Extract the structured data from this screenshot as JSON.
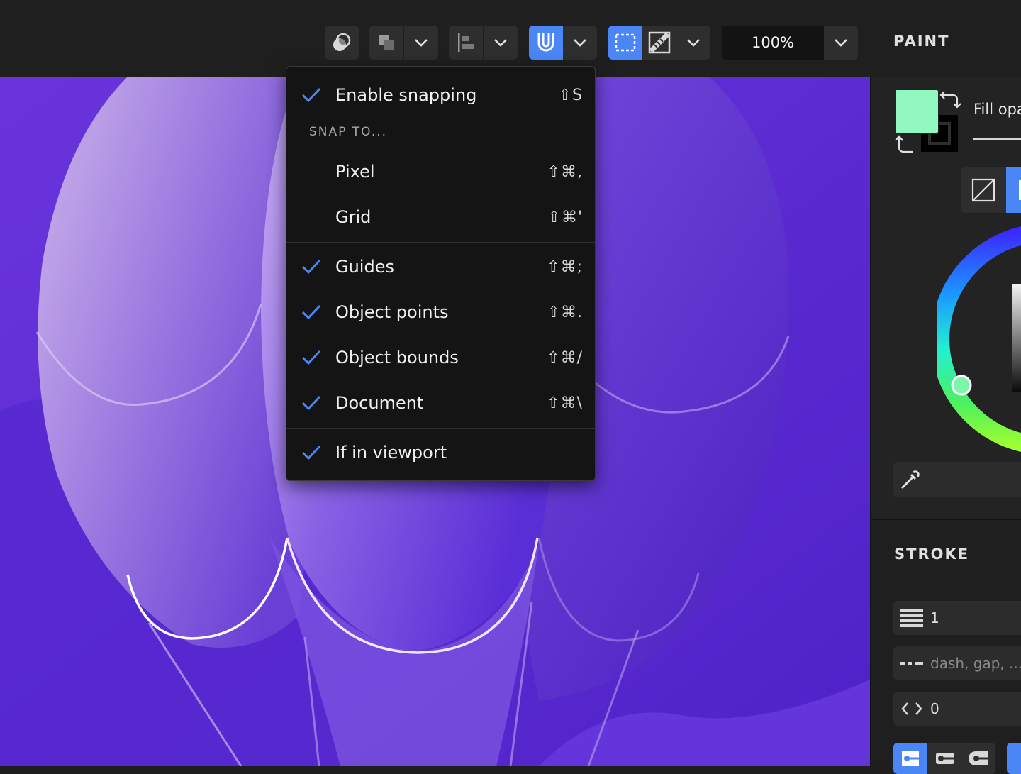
{
  "toolbar": {
    "zoom_value": "100%",
    "snapping_active": true
  },
  "panels": {
    "paint_title": "PAINT",
    "fill_label": "Fill opa",
    "stroke_title": "STROKE",
    "stroke_width": "1",
    "dash_placeholder": "dash, gap, ...",
    "offset_value": "0",
    "fill_color": "#92f8c2",
    "stroke_color": "#000000"
  },
  "snap_menu": {
    "enable_label": "Enable snapping",
    "enable_shortcut": "⇧S",
    "heading": "SNAP TO...",
    "items": [
      {
        "label": "Pixel",
        "shortcut": "⇧⌘,",
        "checked": false
      },
      {
        "label": "Grid",
        "shortcut": "⇧⌘'",
        "checked": false
      },
      {
        "label": "Guides",
        "shortcut": "⇧⌘;",
        "checked": true
      },
      {
        "label": "Object points",
        "shortcut": "⇧⌘.",
        "checked": true
      },
      {
        "label": "Object bounds",
        "shortcut": "⇧⌘/",
        "checked": true
      },
      {
        "label": "Document",
        "shortcut": "⇧⌘\\",
        "checked": true
      },
      {
        "label": "If in viewport",
        "shortcut": "",
        "checked": true
      }
    ]
  },
  "colors": {
    "accent": "#4a86f5",
    "canvas_bg": "#5a2ed6",
    "menu_bg": "#141414"
  }
}
